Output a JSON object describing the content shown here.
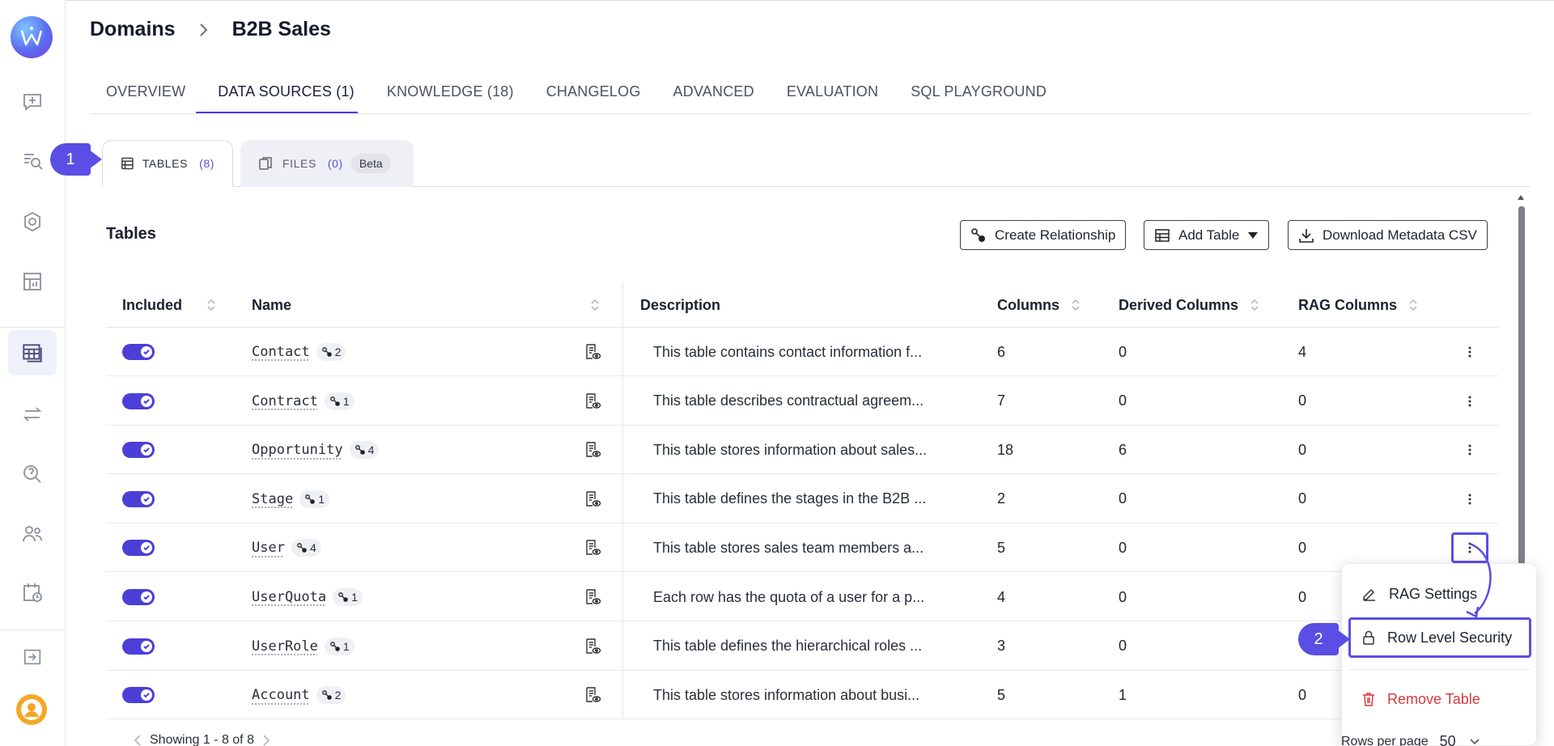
{
  "breadcrumb": {
    "root": "Domains",
    "current": "B2B Sales"
  },
  "tabs": [
    {
      "label": "OVERVIEW"
    },
    {
      "label": "DATA SOURCES (1)"
    },
    {
      "label": "KNOWLEDGE (18)"
    },
    {
      "label": "CHANGELOG"
    },
    {
      "label": "ADVANCED"
    },
    {
      "label": "EVALUATION"
    },
    {
      "label": "SQL PLAYGROUND"
    }
  ],
  "subtabs": {
    "tables": {
      "label": "TABLES",
      "count": "(8)"
    },
    "files": {
      "label": "FILES",
      "count": "(0)",
      "badge": "Beta"
    }
  },
  "markers": {
    "one": "1",
    "two": "2"
  },
  "section": {
    "title": "Tables"
  },
  "buttons": {
    "create_relationship": "Create Relationship",
    "add_table": "Add Table",
    "download_csv": "Download Metadata CSV"
  },
  "table": {
    "headers": {
      "included": "Included",
      "name": "Name",
      "description": "Description",
      "columns": "Columns",
      "derived": "Derived Columns",
      "rag": "RAG Columns"
    },
    "rows": [
      {
        "name": "Contact",
        "rel": "2",
        "desc": "This table contains contact information f...",
        "columns": "6",
        "derived": "0",
        "rag": "4"
      },
      {
        "name": "Contract",
        "rel": "1",
        "desc": "This table describes contractual agreem...",
        "columns": "7",
        "derived": "0",
        "rag": "0"
      },
      {
        "name": "Opportunity",
        "rel": "4",
        "desc": "This table stores information about sales...",
        "columns": "18",
        "derived": "6",
        "rag": "0"
      },
      {
        "name": "Stage",
        "rel": "1",
        "desc": "This table defines the stages in the B2B ...",
        "columns": "2",
        "derived": "0",
        "rag": "0"
      },
      {
        "name": "User",
        "rel": "4",
        "desc": "This table stores sales team members a...",
        "columns": "5",
        "derived": "0",
        "rag": "0"
      },
      {
        "name": "UserQuota",
        "rel": "1",
        "desc": "Each row has the quota of a user for a p...",
        "columns": "4",
        "derived": "0",
        "rag": "0"
      },
      {
        "name": "UserRole",
        "rel": "1",
        "desc": "This table defines the hierarchical roles ...",
        "columns": "3",
        "derived": "0",
        "rag": ""
      },
      {
        "name": "Account",
        "rel": "2",
        "desc": "This table stores information about busi...",
        "columns": "5",
        "derived": "1",
        "rag": "0"
      }
    ]
  },
  "menu": {
    "rag_settings": "RAG Settings",
    "row_level_security": "Row Level Security",
    "remove_table": "Remove Table"
  },
  "footer": {
    "showing": "Showing 1 - 8 of 8",
    "rows_per_page_label": "Rows per page",
    "rows_per_page_value": "50"
  },
  "colors": {
    "accent": "#4b3fd8",
    "danger": "#d63a3a"
  }
}
